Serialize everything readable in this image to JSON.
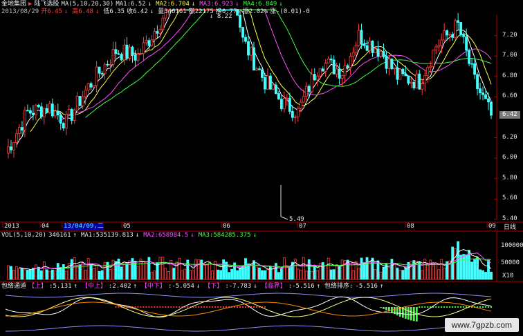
{
  "header": {
    "tab": "金地集团",
    "arrow": "▶",
    "stock_name": "陆飞选股",
    "ma_label": "MA(5,10,20,30)",
    "ma1": "MA1:6.52",
    "ma1_arrow": "↓",
    "ma2": "MA2:6.704",
    "ma2_arrow": "↓",
    "ma3": "MA3:6.923",
    "ma3_arrow": "↓",
    "ma4": "MA4:6.849",
    "ma4_arrow": "↓"
  },
  "quote": {
    "date": "2013/08/29",
    "open": "开6.45",
    "open_arrow": "↓",
    "high": "高6.48",
    "high_arrow": "↓",
    "low": "低6.35",
    "close": "收6.42",
    "close_arrow": "↓",
    "volume": "量346161",
    "amount": "额22175",
    "turnover": "换0.77%",
    "amplitude": "振2.02%",
    "change": "涨-(0.01)-0"
  },
  "price_axis": {
    "labels": [
      "7.20",
      "7.00",
      "6.80",
      "6.60",
      "6.42",
      "6.20",
      "6.00",
      "5.80",
      "5.60",
      "5.40"
    ],
    "current": "6.42",
    "unit": "日线"
  },
  "annotations": {
    "high_mark": "8.22",
    "low_mark": "5.49"
  },
  "time_axis": {
    "labels": [
      "2013",
      "04",
      "13/04/09,二",
      "05",
      "06",
      "07",
      "08",
      "09"
    ]
  },
  "volume_panel": {
    "title": "VOL(5,10,20)",
    "vol": "346161",
    "vol_arrow": "↑",
    "ma1": "MA1:535139.813",
    "ma1_arrow": "↓",
    "ma2": "MA2:658984.5",
    "ma2_arrow": "↓",
    "ma3": "MA3:584285.375",
    "ma3_arrow": "↓",
    "axis": [
      "100000",
      "50000"
    ],
    "unit": "X10"
  },
  "indicator_panel": {
    "title": "包络通道",
    "upper_label": "【上】",
    "upper": "5.131",
    "upper_arrow": "↑",
    "midup_label": "【中上】",
    "midup": "2.402",
    "midup_arrow": "↑",
    "middown_label": "【中下】",
    "middown": "-5.054",
    "middown_arrow": "↓",
    "lower_label": "【下】",
    "lower": "-7.783",
    "lower_arrow": "↓",
    "bound_label": "【临界】",
    "bound": "-5.516",
    "bound_arrow": "↑",
    "rank_label": "包络排序:",
    "rank": "-5.516",
    "rank_arrow": "↑"
  },
  "watermark": "www.7gpzb.com",
  "colors": {
    "up": "#ff4040",
    "down": "#40ffff",
    "ma1": "#ffffff",
    "ma2": "#ffff40",
    "ma3": "#ff50ff",
    "ma4": "#40ff40",
    "grid": "#8b0000"
  }
}
